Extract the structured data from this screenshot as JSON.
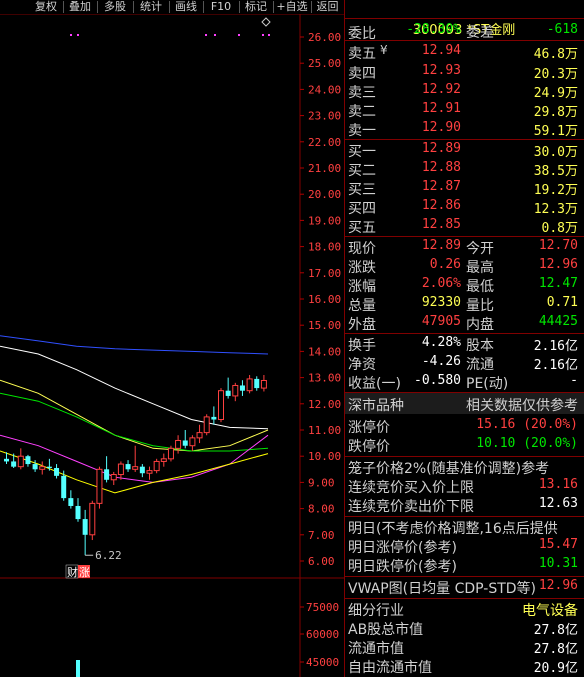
{
  "toolbar": {
    "buttons": [
      "复权",
      "叠加",
      "多股",
      "统计",
      "画线",
      "F10",
      "标记",
      "+自选",
      "返回"
    ]
  },
  "chart": {
    "price_ticks": [
      "26.00",
      "25.00",
      "24.00",
      "23.00",
      "22.00",
      "21.00",
      "20.00",
      "19.00",
      "18.00",
      "17.00",
      "16.00",
      "15.00",
      "14.00",
      "13.00",
      "12.00",
      "11.00",
      "10.00",
      "9.00",
      "8.00",
      "7.00",
      "6.00"
    ],
    "volume_ticks": [
      "75000",
      "60000",
      "45000"
    ],
    "low_marker": "6.22",
    "badge_1": "财",
    "badge_2": "涨",
    "diamond_icon": "diamond-icon"
  },
  "chart_data": {
    "type": "candlestick",
    "price_axis_range": [
      6.0,
      26.0
    ],
    "price_axis_ticks": [
      26,
      25,
      24,
      23,
      22,
      21,
      20,
      19,
      18,
      17,
      16,
      15,
      14,
      13,
      12,
      11,
      10,
      9,
      8,
      7,
      6
    ],
    "volume_axis_ticks": [
      75000,
      60000,
      45000
    ],
    "annotation_low": 6.22,
    "candles": [
      {
        "o": 9.9,
        "h": 10.15,
        "l": 9.7,
        "c": 9.8
      },
      {
        "o": 9.8,
        "h": 10.1,
        "l": 9.55,
        "c": 9.6
      },
      {
        "o": 9.6,
        "h": 10.3,
        "l": 9.5,
        "c": 10.0
      },
      {
        "o": 10.0,
        "h": 10.05,
        "l": 9.6,
        "c": 9.7
      },
      {
        "o": 9.7,
        "h": 9.85,
        "l": 9.4,
        "c": 9.5
      },
      {
        "o": 9.5,
        "h": 9.8,
        "l": 9.3,
        "c": 9.6
      },
      {
        "o": 9.6,
        "h": 9.9,
        "l": 9.45,
        "c": 9.55
      },
      {
        "o": 9.55,
        "h": 9.7,
        "l": 9.15,
        "c": 9.25
      },
      {
        "o": 9.25,
        "h": 9.45,
        "l": 8.3,
        "c": 8.4
      },
      {
        "o": 8.4,
        "h": 8.7,
        "l": 8.0,
        "c": 8.1
      },
      {
        "o": 8.1,
        "h": 8.4,
        "l": 7.5,
        "c": 7.6
      },
      {
        "o": 7.6,
        "h": 7.95,
        "l": 6.22,
        "c": 7.0
      },
      {
        "o": 7.0,
        "h": 8.3,
        "l": 6.8,
        "c": 8.2
      },
      {
        "o": 8.2,
        "h": 9.6,
        "l": 8.0,
        "c": 9.5
      },
      {
        "o": 9.5,
        "h": 10.0,
        "l": 9.0,
        "c": 9.1
      },
      {
        "o": 9.1,
        "h": 9.4,
        "l": 8.9,
        "c": 9.3
      },
      {
        "o": 9.3,
        "h": 9.8,
        "l": 9.1,
        "c": 9.7
      },
      {
        "o": 9.7,
        "h": 9.85,
        "l": 9.4,
        "c": 9.5
      },
      {
        "o": 9.5,
        "h": 10.4,
        "l": 9.4,
        "c": 9.6
      },
      {
        "o": 9.6,
        "h": 9.7,
        "l": 9.2,
        "c": 9.35
      },
      {
        "o": 9.35,
        "h": 9.6,
        "l": 9.1,
        "c": 9.45
      },
      {
        "o": 9.45,
        "h": 9.9,
        "l": 9.35,
        "c": 9.8
      },
      {
        "o": 9.8,
        "h": 10.1,
        "l": 9.6,
        "c": 9.9
      },
      {
        "o": 9.9,
        "h": 10.4,
        "l": 9.8,
        "c": 10.3
      },
      {
        "o": 10.3,
        "h": 10.8,
        "l": 10.1,
        "c": 10.6
      },
      {
        "o": 10.6,
        "h": 11.0,
        "l": 10.3,
        "c": 10.4
      },
      {
        "o": 10.4,
        "h": 10.8,
        "l": 10.2,
        "c": 10.7
      },
      {
        "o": 10.7,
        "h": 11.2,
        "l": 10.5,
        "c": 10.9
      },
      {
        "o": 10.9,
        "h": 11.6,
        "l": 10.8,
        "c": 11.5
      },
      {
        "o": 11.5,
        "h": 11.9,
        "l": 11.2,
        "c": 11.4
      },
      {
        "o": 11.4,
        "h": 12.6,
        "l": 11.3,
        "c": 12.5
      },
      {
        "o": 12.5,
        "h": 13.0,
        "l": 12.2,
        "c": 12.3
      },
      {
        "o": 12.3,
        "h": 12.8,
        "l": 12.1,
        "c": 12.7
      },
      {
        "o": 12.7,
        "h": 12.9,
        "l": 12.3,
        "c": 12.5
      },
      {
        "o": 12.5,
        "h": 13.1,
        "l": 12.4,
        "c": 12.95
      },
      {
        "o": 12.95,
        "h": 13.05,
        "l": 12.5,
        "c": 12.6
      },
      {
        "o": 12.6,
        "h": 13.1,
        "l": 12.47,
        "c": 12.89
      }
    ],
    "moving_averages": [
      {
        "color": "#ffffff",
        "values": [
          14.2,
          13.9,
          13.3,
          12.6,
          12.0,
          11.4,
          11.1,
          11.05
        ]
      },
      {
        "color": "#ffff54",
        "values": [
          12.9,
          12.4,
          11.6,
          10.8,
          10.3,
          10.2,
          10.4,
          11.0
        ]
      },
      {
        "color": "#00e600",
        "values": [
          12.4,
          12.1,
          11.5,
          10.8,
          10.4,
          10.2,
          10.2,
          10.3
        ]
      },
      {
        "color": "#ff40ff",
        "values": [
          10.8,
          10.4,
          9.8,
          9.2,
          9.0,
          9.2,
          9.7,
          10.8
        ]
      },
      {
        "color": "#ffff00",
        "values": [
          10.2,
          9.7,
          9.1,
          8.6,
          9.0,
          9.3,
          9.7,
          10.1
        ]
      },
      {
        "color": "#3050ff",
        "values": [
          14.6,
          14.4,
          14.2,
          14.1,
          14.05,
          14.0,
          13.95,
          13.9
        ]
      }
    ]
  },
  "panel": {
    "header": "300093 *ST金刚",
    "webi": {
      "label": "委比",
      "pct": "-28.30%",
      "diff_label": "委差",
      "diff": "-618"
    },
    "asks": [
      {
        "label": "卖五",
        "price": "12.94",
        "vol": "46.8万"
      },
      {
        "label": "卖四",
        "price": "12.93",
        "vol": "20.3万"
      },
      {
        "label": "卖三",
        "price": "12.92",
        "vol": "24.9万"
      },
      {
        "label": "卖二",
        "price": "12.91",
        "vol": "29.8万"
      },
      {
        "label": "卖一",
        "price": "12.90",
        "vol": "59.1万"
      }
    ],
    "bids": [
      {
        "label": "买一",
        "price": "12.89",
        "vol": "30.0万"
      },
      {
        "label": "买二",
        "price": "12.88",
        "vol": "38.5万"
      },
      {
        "label": "买三",
        "price": "12.87",
        "vol": "19.2万"
      },
      {
        "label": "买四",
        "price": "12.86",
        "vol": "12.3万"
      },
      {
        "label": "买五",
        "price": "12.85",
        "vol": "0.8万"
      }
    ],
    "quote": [
      {
        "l1": "现价",
        "v1": "12.89",
        "c1": "red",
        "l2": "今开",
        "v2": "12.70",
        "c2": "red"
      },
      {
        "l1": "涨跌",
        "v1": "0.26",
        "c1": "red",
        "l2": "最高",
        "v2": "12.96",
        "c2": "red"
      },
      {
        "l1": "涨幅",
        "v1": "2.06%",
        "c1": "red",
        "l2": "最低",
        "v2": "12.47",
        "c2": "green"
      },
      {
        "l1": "总量",
        "v1": "92330",
        "c1": "yellow",
        "l2": "量比",
        "v2": "0.71",
        "c2": "yellow"
      },
      {
        "l1": "外盘",
        "v1": "47905",
        "c1": "red",
        "l2": "内盘",
        "v2": "44425",
        "c2": "green"
      }
    ],
    "stats": [
      {
        "l1": "换手",
        "v1": "4.28%",
        "l2": "股本",
        "v2": "2.16亿"
      },
      {
        "l1": "净资",
        "v1": "-4.26",
        "l2": "流通",
        "v2": "2.16亿"
      },
      {
        "l1": "收益(一)",
        "v1": "-0.580",
        "l2": "PE(动)",
        "v2": "-"
      }
    ],
    "market": {
      "left": "深市品种",
      "right": "相关数据仅供参考"
    },
    "limit_up": {
      "label": "涨停价",
      "value": "15.16 (20.0%)"
    },
    "limit_down": {
      "label": "跌停价",
      "value": "10.10 (20.0%)"
    },
    "cage_title": "笼子价格2%(随基准价调整)参考",
    "auction_buy": {
      "label": "连续竞价买入价上限",
      "value": "13.16"
    },
    "auction_sell": {
      "label": "连续竞价卖出价下限",
      "value": "12.63"
    },
    "tomorrow_title": "明日(不考虑价格调整,16点后提供",
    "tomorrow_up": {
      "label": "明日涨停价(参考)",
      "value": "15.47"
    },
    "tomorrow_down": {
      "label": "明日跌停价(参考)",
      "value": "10.31"
    },
    "vwap": {
      "label": "VWAP图(日均量 CDP-STD等)",
      "value": "12.96"
    },
    "industry": {
      "label": "细分行业",
      "value": "电气设备"
    },
    "ab_cap": {
      "label": "AB股总市值",
      "value": "27.8亿"
    },
    "float_cap": {
      "label": "流通市值",
      "value": "27.8亿"
    },
    "free_cap": {
      "label": "自由流通市值",
      "value": "20.9亿"
    }
  }
}
